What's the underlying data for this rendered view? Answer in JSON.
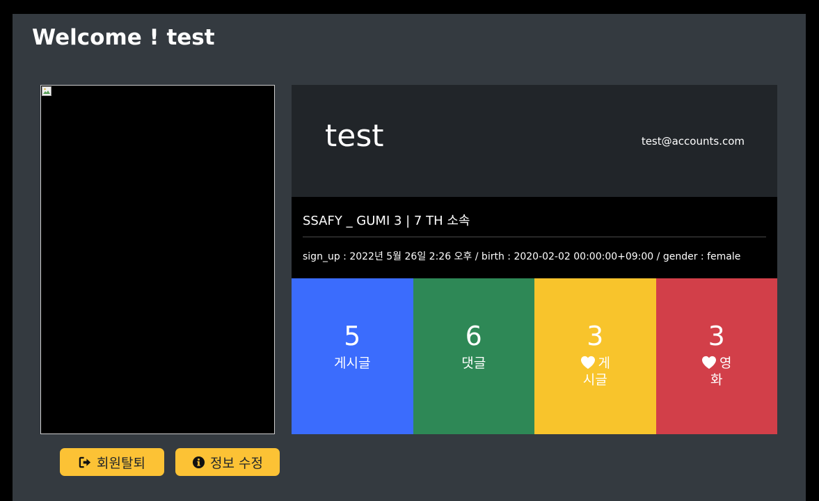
{
  "page": {
    "welcome": "Welcome ! test"
  },
  "profile": {
    "username": "test",
    "email": "test@accounts.com",
    "affiliation": "SSAFY _ GUMI 3 | 7 TH 소속",
    "meta": "sign_up : 2022년 5월 26일 2:26 오후 / birth : 2020-02-02 00:00:00+09:00 / gender : female"
  },
  "stats": [
    {
      "count": "5",
      "label": "게시글",
      "color": "#3b6cfd",
      "icon": ""
    },
    {
      "count": "6",
      "label": "댓글",
      "color": "#2e8856",
      "icon": ""
    },
    {
      "count": "3",
      "label": "게시글",
      "color": "#f8c42c",
      "icon": "heart-icon"
    },
    {
      "count": "3",
      "label": "영화",
      "color": "#d23f49",
      "icon": "heart-icon"
    }
  ],
  "actions": {
    "withdraw_label": "회원탈퇴",
    "withdraw_icon": "sign-out-icon",
    "edit_label": "정보 수정",
    "edit_icon": "info-circle-icon"
  },
  "colors": {
    "panel_bg": "#343a40",
    "card_head_bg": "#212529",
    "button_bg": "#fcc235"
  }
}
